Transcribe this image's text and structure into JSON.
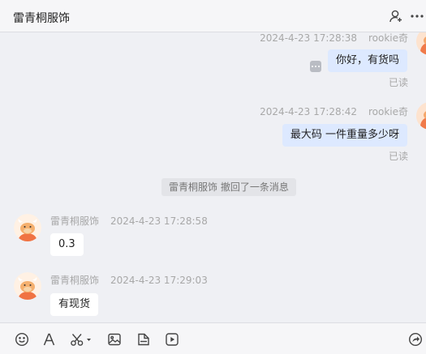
{
  "header": {
    "title": "雷青桐服饰"
  },
  "messages": [
    {
      "sender": "rookie奇",
      "time": "2024-4-23 17:28:38",
      "text": "你好，有货吗",
      "status": "已读"
    },
    {
      "sender": "rookie奇",
      "time": "2024-4-23 17:28:42",
      "text": "最大码  一件重量多少呀",
      "status": "已读"
    },
    {
      "system": "雷青桐服饰 撤回了一条消息"
    },
    {
      "sender": "雷青桐服饰",
      "time": "2024-4-23 17:28:58",
      "text": "0.3"
    },
    {
      "sender": "雷青桐服饰",
      "time": "2024-4-23 17:29:03",
      "text": "有现货"
    }
  ],
  "toolbar": {
    "icons": [
      "emoji-icon",
      "font-icon",
      "scissors-icon",
      "image-icon",
      "file-icon",
      "video-icon",
      "share-icon"
    ]
  }
}
